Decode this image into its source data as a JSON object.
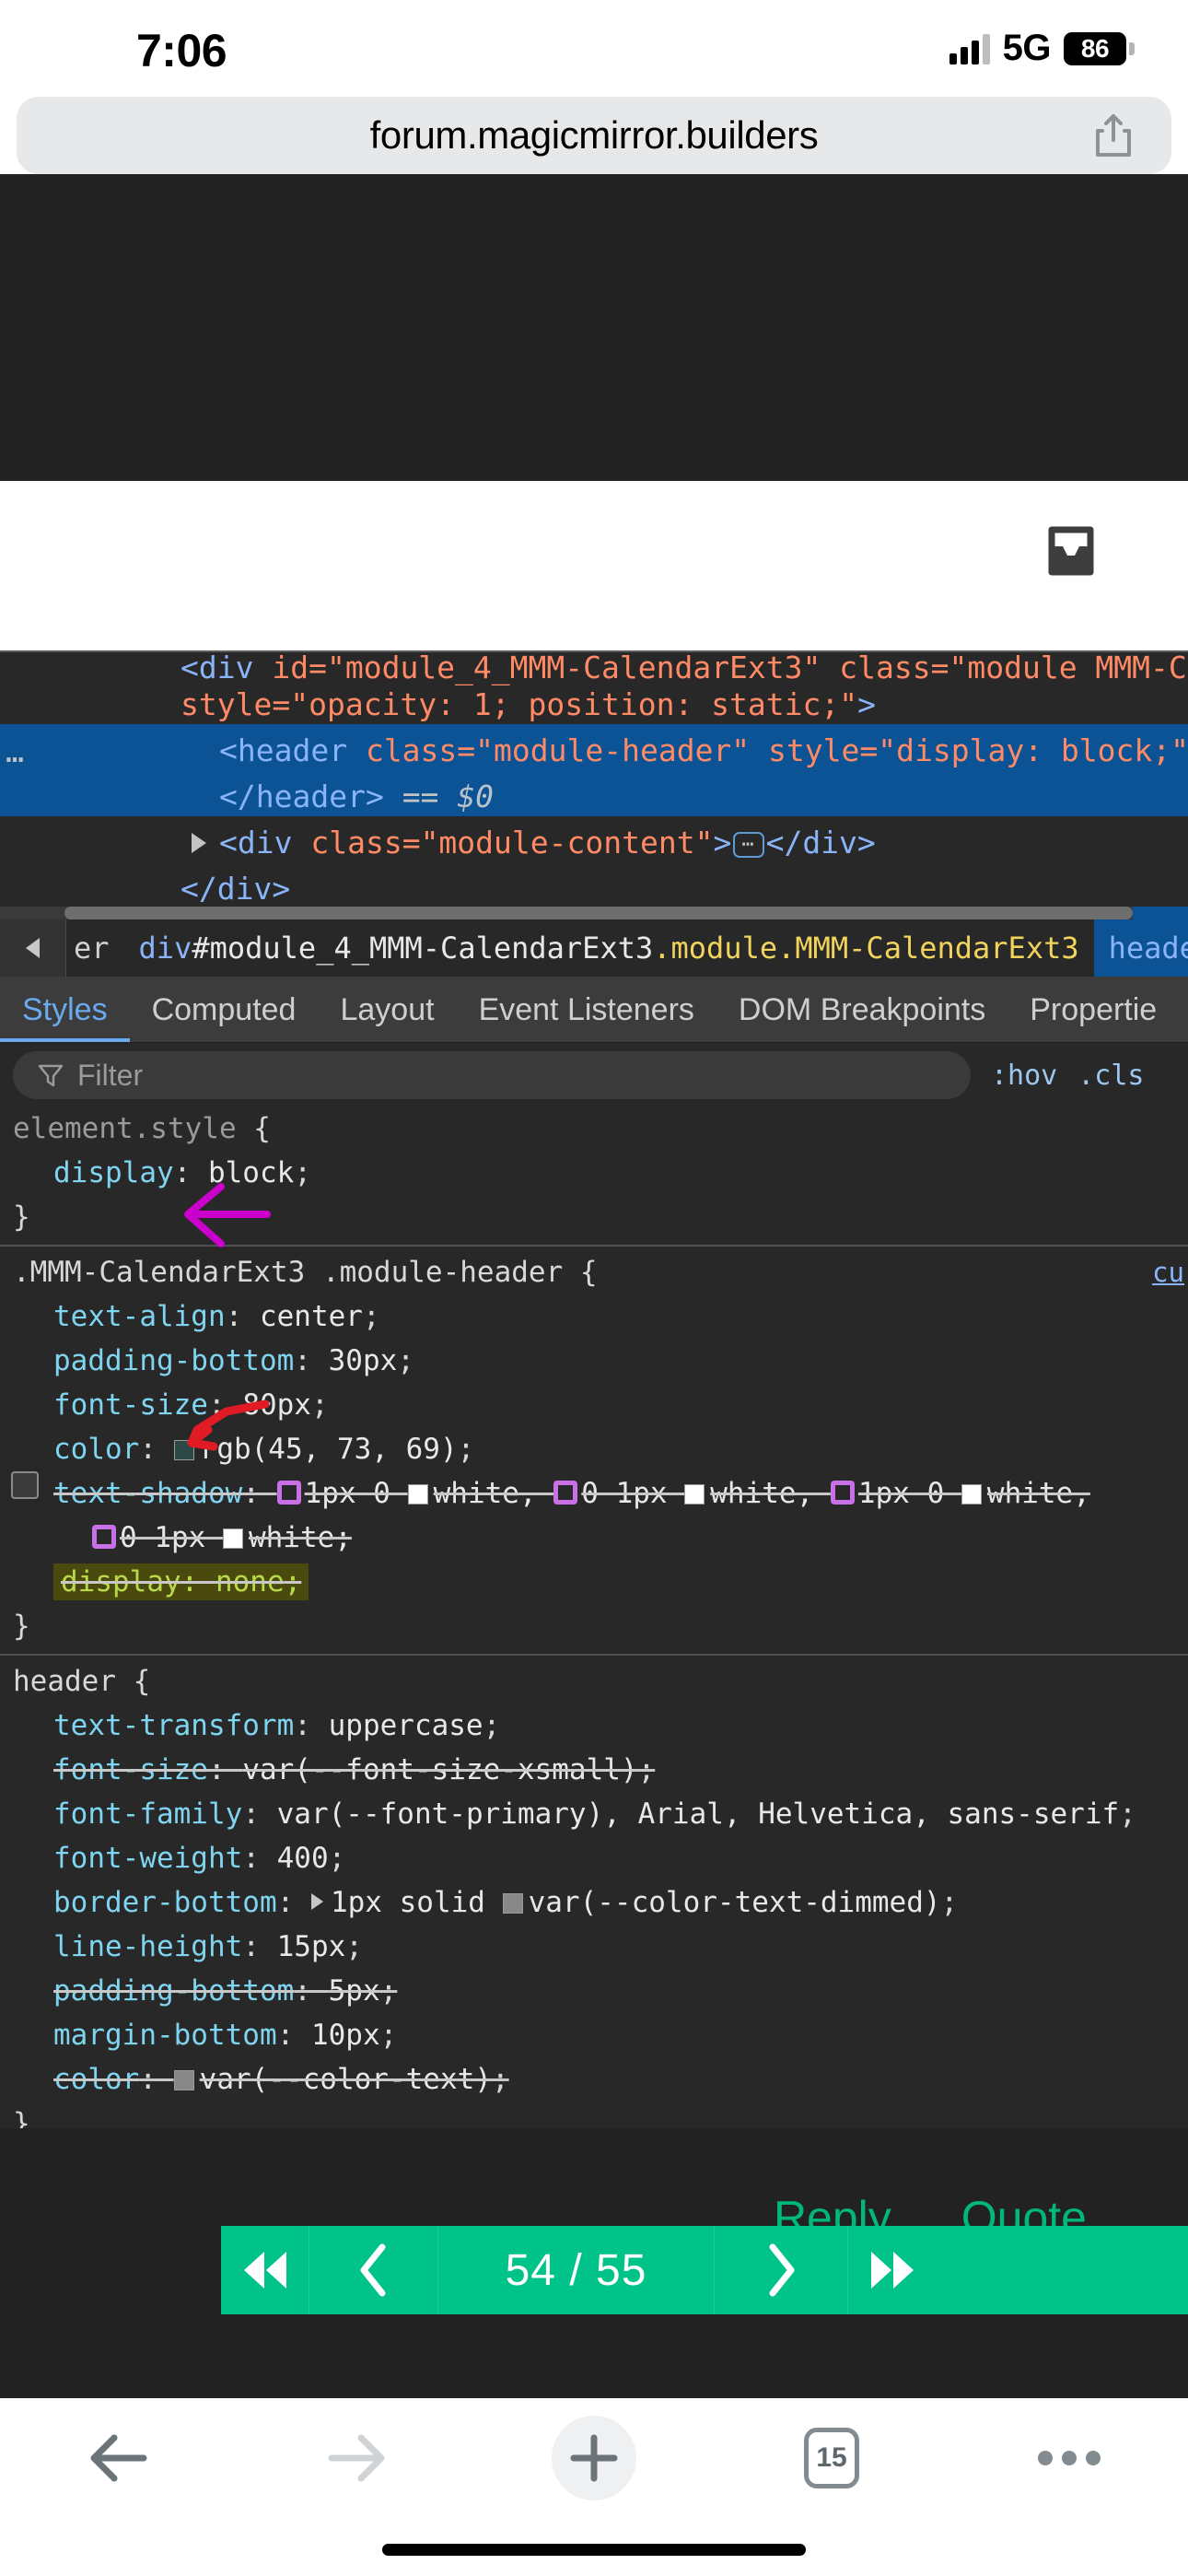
{
  "status_bar": {
    "time": "7:06",
    "network": "5G",
    "battery_percent": "86",
    "signal_icon": "cellular-bars-icon",
    "battery_icon": "battery-icon"
  },
  "browser": {
    "url": "forum.magicmirror.builders",
    "share_icon": "share-icon",
    "toolbar": {
      "back_icon": "back-arrow-icon",
      "forward_icon": "forward-arrow-icon",
      "new_tab_icon": "plus-icon",
      "tabs_icon": "tabs-icon",
      "tabs_count": "15",
      "more_icon": "more-dots-icon"
    }
  },
  "page_top": {
    "inbox_icon": "inbox-icon"
  },
  "devtools": {
    "dom_tree": {
      "lines": [
        {
          "id": "line-1",
          "selected": false,
          "clipped_top": true,
          "segments": [
            {
              "t": "<div ",
              "c": "tag"
            },
            {
              "t": "id=",
              "c": "attr"
            },
            {
              "t": "\"module_4_MMM-CalendarExt3\"",
              "c": "val"
            },
            {
              "t": " class=",
              "c": "attr"
            },
            {
              "t": "\"module MMM-Cal",
              "c": "val"
            }
          ],
          "text": "<div id=\"module_4_MMM-CalendarExt3\" class=\"module MMM-Cal"
        },
        {
          "id": "line-2",
          "selected": false,
          "text": "style=\"opacity: 1; position: static;\">"
        },
        {
          "id": "line-3",
          "selected": true,
          "text": "<header class=\"module-header\" style=\"display: block;\">S"
        },
        {
          "id": "line-4",
          "selected": true,
          "text": "</header> == $0"
        },
        {
          "id": "line-5",
          "selected": false,
          "has_expander": true,
          "text": "<div class=\"module-content\">…</div>"
        },
        {
          "id": "line-6",
          "selected": false,
          "text": "</div>"
        }
      ],
      "ellipsis_marker": "…"
    },
    "breadcrumb": {
      "scroll_left_icon": "chevron-left-icon",
      "items": [
        {
          "label": "er",
          "clipped": true
        },
        {
          "tag": "div",
          "id": "#module_4_MMM-CalendarExt3",
          "classes": ".module.MMM-CalendarExt3",
          "active": true
        },
        {
          "label": "header.m",
          "clipped": true,
          "highlighted": true
        }
      ]
    },
    "tabs": [
      {
        "label": "Styles",
        "active": true
      },
      {
        "label": "Computed",
        "active": false
      },
      {
        "label": "Layout",
        "active": false
      },
      {
        "label": "Event Listeners",
        "active": false
      },
      {
        "label": "DOM Breakpoints",
        "active": false
      },
      {
        "label": "Propertie",
        "active": false,
        "clipped": true
      }
    ],
    "filter": {
      "icon": "filter-icon",
      "placeholder": "Filter",
      "value": "",
      "hov_label": ":hov",
      "cls_label": ".cls"
    },
    "rules": [
      {
        "selector": "element.style",
        "is_element_style": true,
        "source": "",
        "declarations": [
          {
            "prop": "display",
            "value": "block",
            "struck": false,
            "checkbox": false
          }
        ]
      },
      {
        "selector": ".MMM-CalendarExt3 .module-header",
        "is_element_style": false,
        "source": "cu",
        "declarations": [
          {
            "prop": "text-align",
            "value": "center",
            "struck": false,
            "checkbox": false
          },
          {
            "prop": "padding-bottom",
            "value": "30px",
            "struck": false,
            "checkbox": false
          },
          {
            "prop": "font-size",
            "value": "80px",
            "struck": false,
            "checkbox": false
          },
          {
            "prop": "color",
            "value": "rgb(45, 73, 69)",
            "swatch": "#2d4945",
            "struck": false,
            "checkbox": false
          },
          {
            "prop": "text-shadow",
            "value": "1px 0 white, 0 1px white, 1px 0 white, 0 1px white",
            "struck": true,
            "checkbox": true
          },
          {
            "prop": "display",
            "value": "none",
            "struck": true,
            "checkbox": false,
            "highlight": true
          }
        ]
      },
      {
        "selector": "header",
        "is_element_style": false,
        "source": "",
        "declarations": [
          {
            "prop": "text-transform",
            "value": "uppercase",
            "struck": false,
            "checkbox": false
          },
          {
            "prop": "font-size",
            "value": "var(--font-size-xsmall)",
            "struck": true,
            "checkbox": false
          },
          {
            "prop": "font-family",
            "value": "var(--font-primary), Arial, Helvetica, sans-serif",
            "struck": false,
            "checkbox": false
          },
          {
            "prop": "font-weight",
            "value": "400",
            "struck": false,
            "checkbox": false
          },
          {
            "prop": "border-bottom",
            "value": "1px solid var(--color-text-dimmed)",
            "swatch": "#888888",
            "expander": true,
            "struck": false,
            "checkbox": false
          },
          {
            "prop": "line-height",
            "value": "15px",
            "struck": false,
            "checkbox": false
          },
          {
            "prop": "padding-bottom",
            "value": "5px",
            "struck": true,
            "checkbox": false
          },
          {
            "prop": "margin-bottom",
            "value": "10px",
            "struck": false,
            "checkbox": false
          },
          {
            "prop": "color",
            "value": "var(--color-text)",
            "swatch": "#888888",
            "struck": true,
            "checkbox": false
          }
        ]
      }
    ],
    "annotations": [
      {
        "name": "magenta-arrow",
        "color": "#cc00cc",
        "points_to": "display: block"
      },
      {
        "name": "red-arrow",
        "color": "#e01b24",
        "points_to": "display: none"
      }
    ]
  },
  "forum": {
    "reply_label": "Reply",
    "quote_label": "Quote",
    "accent_color": "#00b87c",
    "pagination": {
      "first_icon": "skip-to-first-icon",
      "prev_icon": "chevron-left-icon",
      "count": "54 / 55",
      "next_icon": "chevron-right-icon",
      "last_icon": "skip-to-last-icon",
      "background_color": "#00c389"
    }
  }
}
